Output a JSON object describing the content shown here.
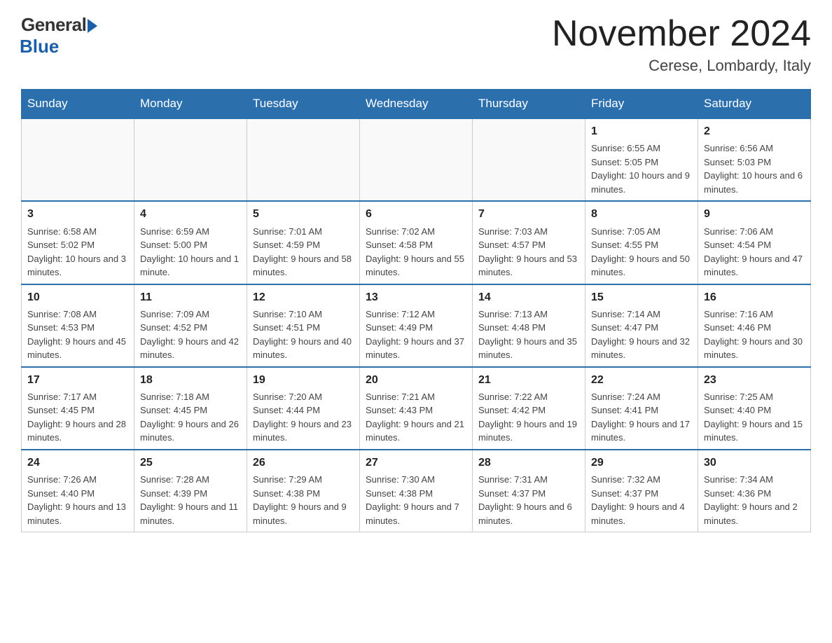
{
  "header": {
    "logo_general": "General",
    "logo_blue": "Blue",
    "month": "November 2024",
    "location": "Cerese, Lombardy, Italy"
  },
  "days_of_week": [
    "Sunday",
    "Monday",
    "Tuesday",
    "Wednesday",
    "Thursday",
    "Friday",
    "Saturday"
  ],
  "weeks": [
    [
      {
        "day": "",
        "info": ""
      },
      {
        "day": "",
        "info": ""
      },
      {
        "day": "",
        "info": ""
      },
      {
        "day": "",
        "info": ""
      },
      {
        "day": "",
        "info": ""
      },
      {
        "day": "1",
        "info": "Sunrise: 6:55 AM\nSunset: 5:05 PM\nDaylight: 10 hours and 9 minutes."
      },
      {
        "day": "2",
        "info": "Sunrise: 6:56 AM\nSunset: 5:03 PM\nDaylight: 10 hours and 6 minutes."
      }
    ],
    [
      {
        "day": "3",
        "info": "Sunrise: 6:58 AM\nSunset: 5:02 PM\nDaylight: 10 hours and 3 minutes."
      },
      {
        "day": "4",
        "info": "Sunrise: 6:59 AM\nSunset: 5:00 PM\nDaylight: 10 hours and 1 minute."
      },
      {
        "day": "5",
        "info": "Sunrise: 7:01 AM\nSunset: 4:59 PM\nDaylight: 9 hours and 58 minutes."
      },
      {
        "day": "6",
        "info": "Sunrise: 7:02 AM\nSunset: 4:58 PM\nDaylight: 9 hours and 55 minutes."
      },
      {
        "day": "7",
        "info": "Sunrise: 7:03 AM\nSunset: 4:57 PM\nDaylight: 9 hours and 53 minutes."
      },
      {
        "day": "8",
        "info": "Sunrise: 7:05 AM\nSunset: 4:55 PM\nDaylight: 9 hours and 50 minutes."
      },
      {
        "day": "9",
        "info": "Sunrise: 7:06 AM\nSunset: 4:54 PM\nDaylight: 9 hours and 47 minutes."
      }
    ],
    [
      {
        "day": "10",
        "info": "Sunrise: 7:08 AM\nSunset: 4:53 PM\nDaylight: 9 hours and 45 minutes."
      },
      {
        "day": "11",
        "info": "Sunrise: 7:09 AM\nSunset: 4:52 PM\nDaylight: 9 hours and 42 minutes."
      },
      {
        "day": "12",
        "info": "Sunrise: 7:10 AM\nSunset: 4:51 PM\nDaylight: 9 hours and 40 minutes."
      },
      {
        "day": "13",
        "info": "Sunrise: 7:12 AM\nSunset: 4:49 PM\nDaylight: 9 hours and 37 minutes."
      },
      {
        "day": "14",
        "info": "Sunrise: 7:13 AM\nSunset: 4:48 PM\nDaylight: 9 hours and 35 minutes."
      },
      {
        "day": "15",
        "info": "Sunrise: 7:14 AM\nSunset: 4:47 PM\nDaylight: 9 hours and 32 minutes."
      },
      {
        "day": "16",
        "info": "Sunrise: 7:16 AM\nSunset: 4:46 PM\nDaylight: 9 hours and 30 minutes."
      }
    ],
    [
      {
        "day": "17",
        "info": "Sunrise: 7:17 AM\nSunset: 4:45 PM\nDaylight: 9 hours and 28 minutes."
      },
      {
        "day": "18",
        "info": "Sunrise: 7:18 AM\nSunset: 4:45 PM\nDaylight: 9 hours and 26 minutes."
      },
      {
        "day": "19",
        "info": "Sunrise: 7:20 AM\nSunset: 4:44 PM\nDaylight: 9 hours and 23 minutes."
      },
      {
        "day": "20",
        "info": "Sunrise: 7:21 AM\nSunset: 4:43 PM\nDaylight: 9 hours and 21 minutes."
      },
      {
        "day": "21",
        "info": "Sunrise: 7:22 AM\nSunset: 4:42 PM\nDaylight: 9 hours and 19 minutes."
      },
      {
        "day": "22",
        "info": "Sunrise: 7:24 AM\nSunset: 4:41 PM\nDaylight: 9 hours and 17 minutes."
      },
      {
        "day": "23",
        "info": "Sunrise: 7:25 AM\nSunset: 4:40 PM\nDaylight: 9 hours and 15 minutes."
      }
    ],
    [
      {
        "day": "24",
        "info": "Sunrise: 7:26 AM\nSunset: 4:40 PM\nDaylight: 9 hours and 13 minutes."
      },
      {
        "day": "25",
        "info": "Sunrise: 7:28 AM\nSunset: 4:39 PM\nDaylight: 9 hours and 11 minutes."
      },
      {
        "day": "26",
        "info": "Sunrise: 7:29 AM\nSunset: 4:38 PM\nDaylight: 9 hours and 9 minutes."
      },
      {
        "day": "27",
        "info": "Sunrise: 7:30 AM\nSunset: 4:38 PM\nDaylight: 9 hours and 7 minutes."
      },
      {
        "day": "28",
        "info": "Sunrise: 7:31 AM\nSunset: 4:37 PM\nDaylight: 9 hours and 6 minutes."
      },
      {
        "day": "29",
        "info": "Sunrise: 7:32 AM\nSunset: 4:37 PM\nDaylight: 9 hours and 4 minutes."
      },
      {
        "day": "30",
        "info": "Sunrise: 7:34 AM\nSunset: 4:36 PM\nDaylight: 9 hours and 2 minutes."
      }
    ]
  ]
}
